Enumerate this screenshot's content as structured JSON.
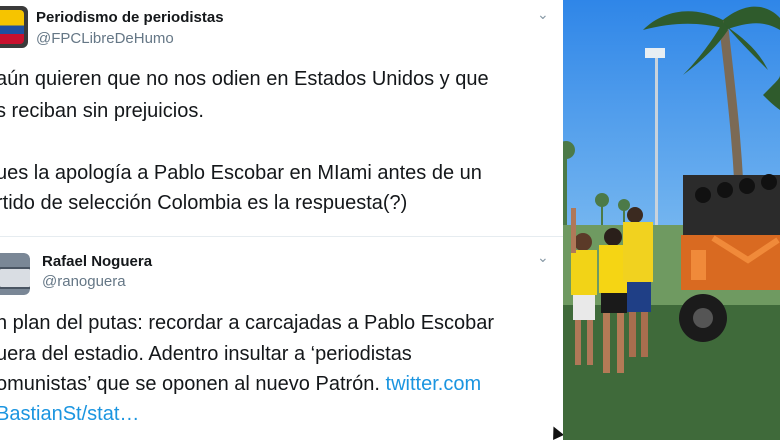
{
  "tweet1": {
    "name": "Periodismo de periodistas",
    "handle": "@FPCLibreDeHumo",
    "lines": [
      "aún quieren que no nos odien en Estados Unidos y que",
      "s reciban sin prejuicios.",
      "",
      "ues la apología a Pablo Escobar en MIami antes de un",
      "rtido de selección Colombia es la respuesta(?)"
    ]
  },
  "tweet2": {
    "name": "Rafael Noguera",
    "handle": "@ranoguera",
    "lines": [
      "n plan del putas: recordar a carcajadas a Pablo Escobar",
      "uera del estadio. Adentro insultar a ‘periodistas",
      "omunistas’ que se oponen al nuevo Patrón."
    ],
    "link1": "twitter.com",
    "link2": "BastianSt/stat…"
  },
  "colors": {
    "link": "#1b95e0",
    "text": "#14171a",
    "muted": "#657786"
  }
}
